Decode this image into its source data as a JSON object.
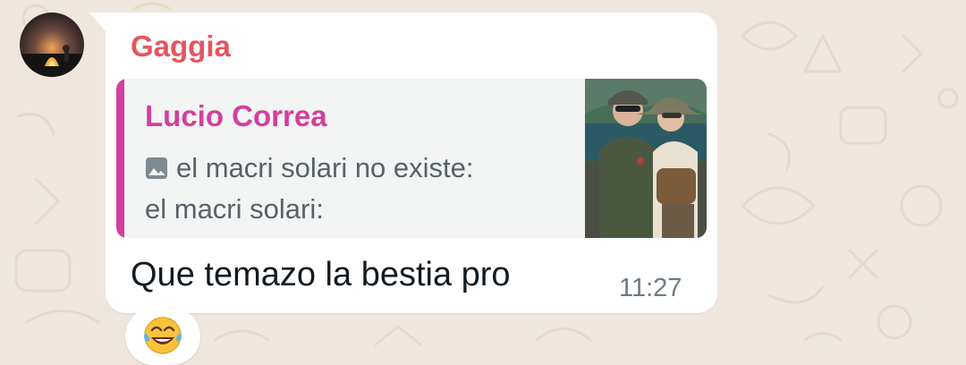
{
  "message": {
    "sender": "Gaggia",
    "text": "Que temazo la bestia pro",
    "time": "11:27",
    "reaction": "face-with-tears-of-joy"
  },
  "quoted_message": {
    "author": "Lucio Correa",
    "line1": "el macri solari no existe:",
    "line2": "el macri solari:",
    "media_icon": "photo-icon",
    "thumbnail": "photo of two people wearing hats and sunglasses near water"
  },
  "colors": {
    "sender_name": "#e5555e",
    "quote_accent": "#d33ea0",
    "chat_background": "#efe7de",
    "bubble": "#ffffff",
    "quote_background": "#f3f4f4"
  }
}
